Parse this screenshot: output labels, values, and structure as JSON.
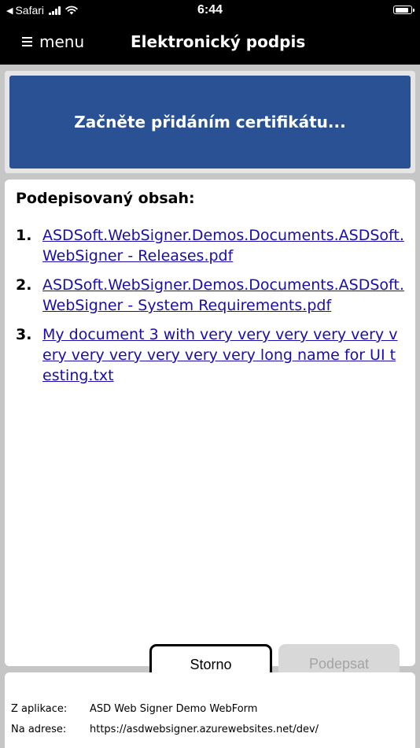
{
  "status_bar": {
    "back_glyph": "◀",
    "carrier": "Safari",
    "time": "6:44"
  },
  "nav": {
    "menu_label": "menu",
    "title": "Elektronický podpis"
  },
  "banner": {
    "text": "Začněte přidáním certifikátu...",
    "color": "#2a5193"
  },
  "content": {
    "heading": "Podepisovaný obsah:",
    "documents": [
      {
        "number": "1.",
        "name": "ASDSoft.WebSigner.Demos.Documents.ASDSoft.WebSigner - Releases.pdf"
      },
      {
        "number": "2.",
        "name": "ASDSoft.WebSigner.Demos.Documents.ASDSoft.WebSigner - System Requirements.pdf"
      },
      {
        "number": "3.",
        "name": "My document 3 with very very very very very very very very very very very long name for UI testing.txt"
      }
    ]
  },
  "actions": {
    "cancel_label": "Storno",
    "sign_label": "Podepsat"
  },
  "footer": {
    "app_label": "Z aplikace:",
    "app_value": "ASD Web Signer Demo WebForm",
    "address_label": "Na adrese:",
    "address_value": "https://asdwebsigner.azurewebsites.net/dev/"
  }
}
